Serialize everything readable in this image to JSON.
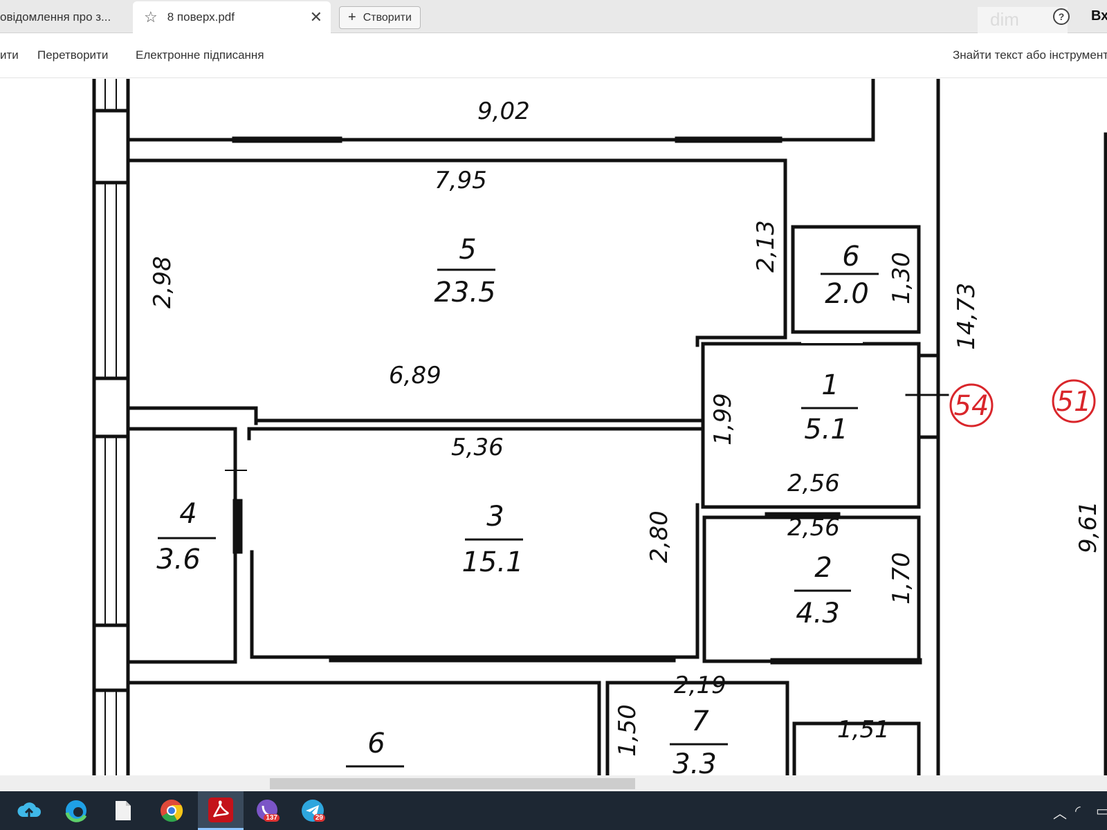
{
  "browser": {
    "tabs": [
      {
        "label": "овідомлення про з..."
      },
      {
        "label": "8 поверх.pdf"
      }
    ],
    "new_button_label": "Створити",
    "brand_watermark": "dim",
    "help_icon": "?",
    "signin_label": "Вх"
  },
  "toolbar": {
    "items": [
      {
        "label": "ити"
      },
      {
        "label": "Перетворити"
      },
      {
        "label": "Електронне підписання"
      }
    ],
    "search_label": "Знайти текст або інструмент"
  },
  "plan": {
    "dims": {
      "top_width": "9,02",
      "room5_top": "7,95",
      "room5_left": "2,98",
      "room5_right": "2,13",
      "corridor_top": "6,89",
      "room3_top": "5,36",
      "room3_right": "2,80",
      "room1_left": "1,99",
      "room1_bottom": "2,56",
      "room2_top": "2,56",
      "room2_right": "1,70",
      "room6_right": "1,30",
      "overall": "14,73",
      "far_right": "9,61",
      "room7_top": "2,19",
      "room7_left": "1,50",
      "bottom_right": "1,51"
    },
    "rooms": {
      "r5": {
        "num": "5",
        "area": "23.5"
      },
      "r6": {
        "num": "6",
        "area": "2.0"
      },
      "r1": {
        "num": "1",
        "area": "5.1"
      },
      "r3": {
        "num": "3",
        "area": "15.1"
      },
      "r4": {
        "num": "4",
        "area": "3.6"
      },
      "r2": {
        "num": "2",
        "area": "4.3"
      },
      "r7": {
        "num": "7",
        "area": "3.3"
      },
      "r6b": {
        "num": "6"
      }
    },
    "apartment_markers": [
      "54",
      "51"
    ],
    "marker_color": "#d9262b"
  },
  "taskbar": {
    "apps": [
      {
        "icon": "cloud-upload-icon"
      },
      {
        "icon": "edge-icon"
      },
      {
        "icon": "file-icon"
      },
      {
        "icon": "chrome-icon"
      },
      {
        "icon": "acrobat-icon"
      },
      {
        "icon": "viber-icon",
        "badge": "137"
      },
      {
        "icon": "telegram-icon",
        "badge": "29"
      }
    ]
  }
}
